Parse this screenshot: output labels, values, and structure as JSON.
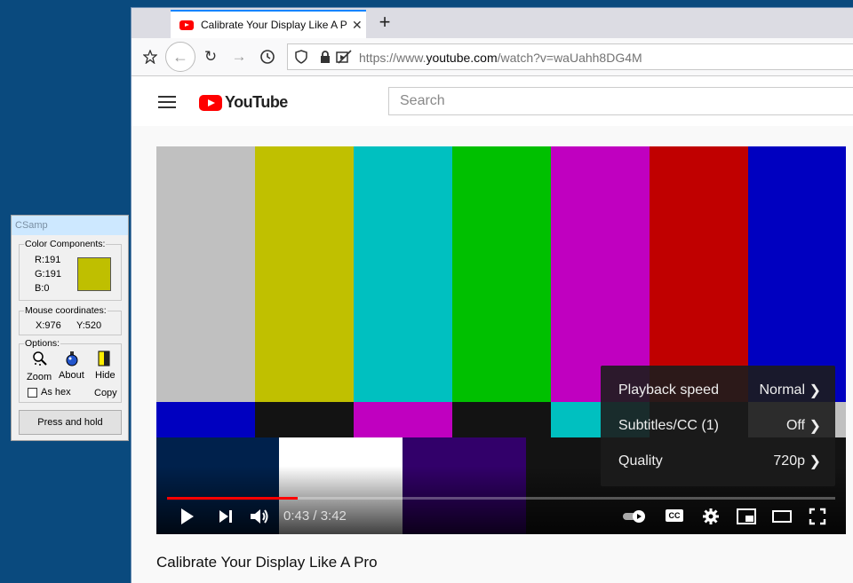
{
  "browser": {
    "tab_title": "Calibrate Your Display Like A Pro",
    "new_tab_label": "+",
    "tab_close": "✕",
    "url_prefix": "https://www.",
    "url_host": "youtube.com",
    "url_path": "/watch?v=waUahh8DG4M"
  },
  "youtube": {
    "logo_text": "YouTube",
    "search_placeholder": "Search",
    "video_title": "Calibrate Your Display Like A Pro",
    "player": {
      "time": "0:43 / 3:42",
      "progress_fraction": 0.195,
      "settings_menu": [
        {
          "label": "Playback speed",
          "value": "Normal"
        },
        {
          "label": "Subtitles/CC (1)",
          "value": "Off"
        },
        {
          "label": "Quality",
          "value": "720p"
        }
      ],
      "cc_label": "CC"
    },
    "test_pattern": {
      "top_bars": [
        "#c0c0c0",
        "#c0c000",
        "#00c0c0",
        "#00c000",
        "#c000c0",
        "#c00000",
        "#0000c0"
      ],
      "mid_bars": [
        "#0000c0",
        "#131313",
        "#c000c0",
        "#131313",
        "#00c0c0",
        "#131313",
        "#c0c0c0"
      ],
      "bottom_bars": [
        "#00214c",
        "#ffffff",
        "#32006a",
        "#131313"
      ]
    }
  },
  "csamp": {
    "title": "CSamp",
    "color_group_label": "Color Components:",
    "r": "R:191",
    "g": "G:191",
    "b": "B:0",
    "swatch_color": "#bfbf00",
    "mouse_group_label": "Mouse coordinates:",
    "x": "X:976",
    "y": "Y:520",
    "options_label": "Options:",
    "zoom_label": "Zoom",
    "about_label": "About",
    "hide_label": "Hide",
    "as_hex_label": "As hex",
    "copy_label": "Copy",
    "press_hold_label": "Press and hold"
  }
}
